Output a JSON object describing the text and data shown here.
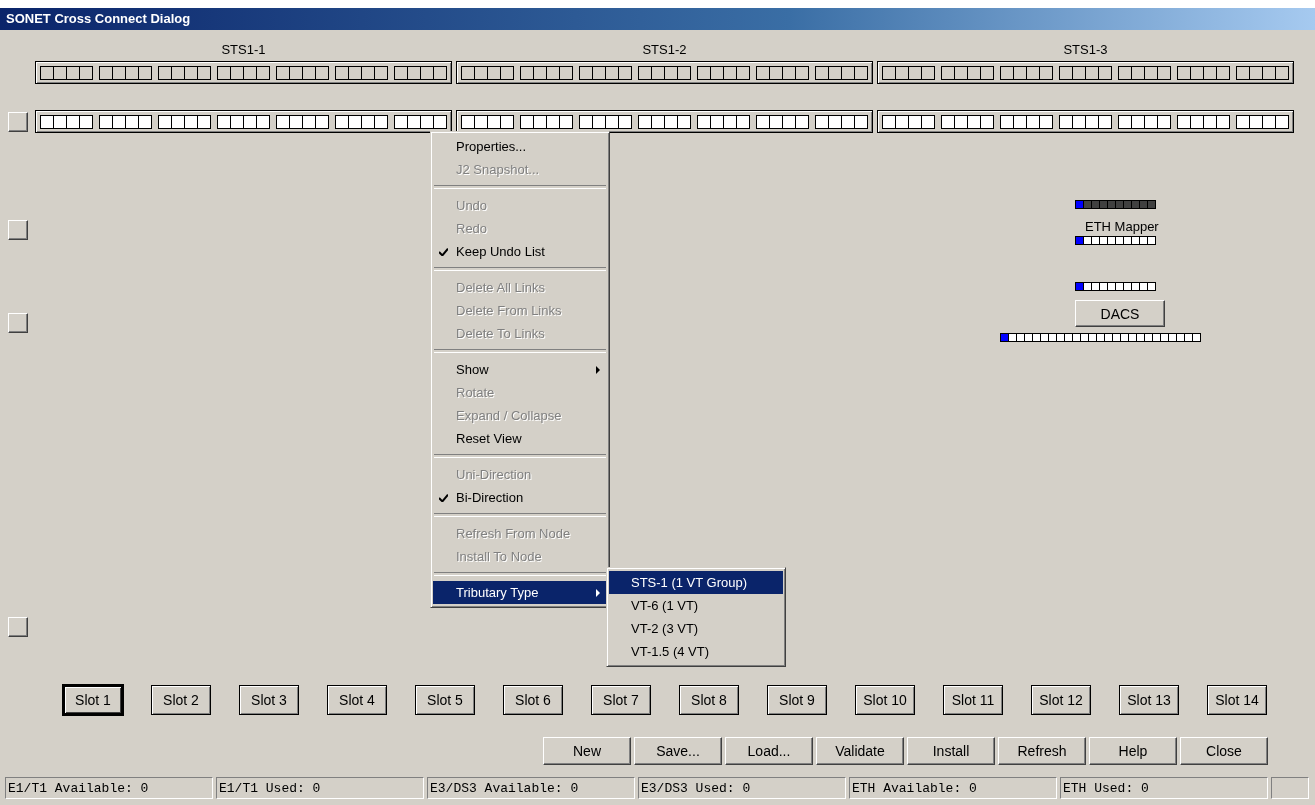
{
  "window": {
    "title": "SONET Cross Connect Dialog"
  },
  "sts_groups": [
    {
      "label": "STS1-1"
    },
    {
      "label": "STS1-2"
    },
    {
      "label": "STS1-3"
    }
  ],
  "rows": [
    {
      "kind": "filled"
    },
    {
      "kind": "open"
    }
  ],
  "modules": [
    {
      "kind": "mapper",
      "label": "ETH Mapper"
    },
    {
      "kind": "dacs",
      "label": "DACS"
    }
  ],
  "context_menu": [
    {
      "kind": "item",
      "label": "Properties...",
      "disabled": false,
      "checked": false,
      "submenu": false,
      "selected": false
    },
    {
      "kind": "item",
      "label": "J2 Snapshot...",
      "disabled": true,
      "checked": false,
      "submenu": false,
      "selected": false
    },
    {
      "kind": "separator"
    },
    {
      "kind": "item",
      "label": "Undo",
      "disabled": true,
      "checked": false,
      "submenu": false,
      "selected": false
    },
    {
      "kind": "item",
      "label": "Redo",
      "disabled": true,
      "checked": false,
      "submenu": false,
      "selected": false
    },
    {
      "kind": "item",
      "label": "Keep Undo List",
      "disabled": false,
      "checked": true,
      "submenu": false,
      "selected": false
    },
    {
      "kind": "separator"
    },
    {
      "kind": "item",
      "label": "Delete All Links",
      "disabled": true,
      "checked": false,
      "submenu": false,
      "selected": false
    },
    {
      "kind": "item",
      "label": "Delete From Links",
      "disabled": true,
      "checked": false,
      "submenu": false,
      "selected": false
    },
    {
      "kind": "item",
      "label": "Delete To Links",
      "disabled": true,
      "checked": false,
      "submenu": false,
      "selected": false
    },
    {
      "kind": "separator"
    },
    {
      "kind": "item",
      "label": "Show",
      "disabled": false,
      "checked": false,
      "submenu": true,
      "selected": false
    },
    {
      "kind": "item",
      "label": "Rotate",
      "disabled": true,
      "checked": false,
      "submenu": false,
      "selected": false
    },
    {
      "kind": "item",
      "label": "Expand / Collapse",
      "disabled": true,
      "checked": false,
      "submenu": false,
      "selected": false
    },
    {
      "kind": "item",
      "label": "Reset View",
      "disabled": false,
      "checked": false,
      "submenu": false,
      "selected": false
    },
    {
      "kind": "separator"
    },
    {
      "kind": "item",
      "label": "Uni-Direction",
      "disabled": true,
      "checked": false,
      "submenu": false,
      "selected": false
    },
    {
      "kind": "item",
      "label": "Bi-Direction",
      "disabled": false,
      "checked": true,
      "submenu": false,
      "selected": false
    },
    {
      "kind": "separator"
    },
    {
      "kind": "item",
      "label": "Refresh From Node",
      "disabled": true,
      "checked": false,
      "submenu": false,
      "selected": false
    },
    {
      "kind": "item",
      "label": "Install To Node",
      "disabled": true,
      "checked": false,
      "submenu": false,
      "selected": false
    },
    {
      "kind": "separator"
    },
    {
      "kind": "item",
      "label": "Tributary Type",
      "disabled": false,
      "checked": false,
      "submenu": true,
      "selected": true
    }
  ],
  "submenu": [
    {
      "label": "STS-1 (1 VT Group)",
      "selected": true
    },
    {
      "label": "VT-6 (1 VT)",
      "selected": false
    },
    {
      "label": "VT-2 (3 VT)",
      "selected": false
    },
    {
      "label": "VT-1.5 (4 VT)",
      "selected": false
    }
  ],
  "slots": [
    {
      "label": "Slot 1",
      "selected": true
    },
    {
      "label": "Slot 2",
      "selected": false
    },
    {
      "label": "Slot 3",
      "selected": false
    },
    {
      "label": "Slot 4",
      "selected": false
    },
    {
      "label": "Slot 5",
      "selected": false
    },
    {
      "label": "Slot 6",
      "selected": false
    },
    {
      "label": "Slot 7",
      "selected": false
    },
    {
      "label": "Slot 8",
      "selected": false
    },
    {
      "label": "Slot 9",
      "selected": false
    },
    {
      "label": "Slot 10",
      "selected": false
    },
    {
      "label": "Slot 11",
      "selected": false
    },
    {
      "label": "Slot 12",
      "selected": false
    },
    {
      "label": "Slot 13",
      "selected": false
    },
    {
      "label": "Slot 14",
      "selected": false
    }
  ],
  "buttons": [
    "New",
    "Save...",
    "Load...",
    "Validate",
    "Install",
    "Refresh",
    "Help",
    "Close"
  ],
  "status_bar": [
    "E1/T1 Available: 0",
    "E1/T1 Used: 0",
    "E3/DS3 Available: 0",
    "E3/DS3 Used: 0",
    "ETH Available: 0",
    "ETH Used: 0"
  ]
}
